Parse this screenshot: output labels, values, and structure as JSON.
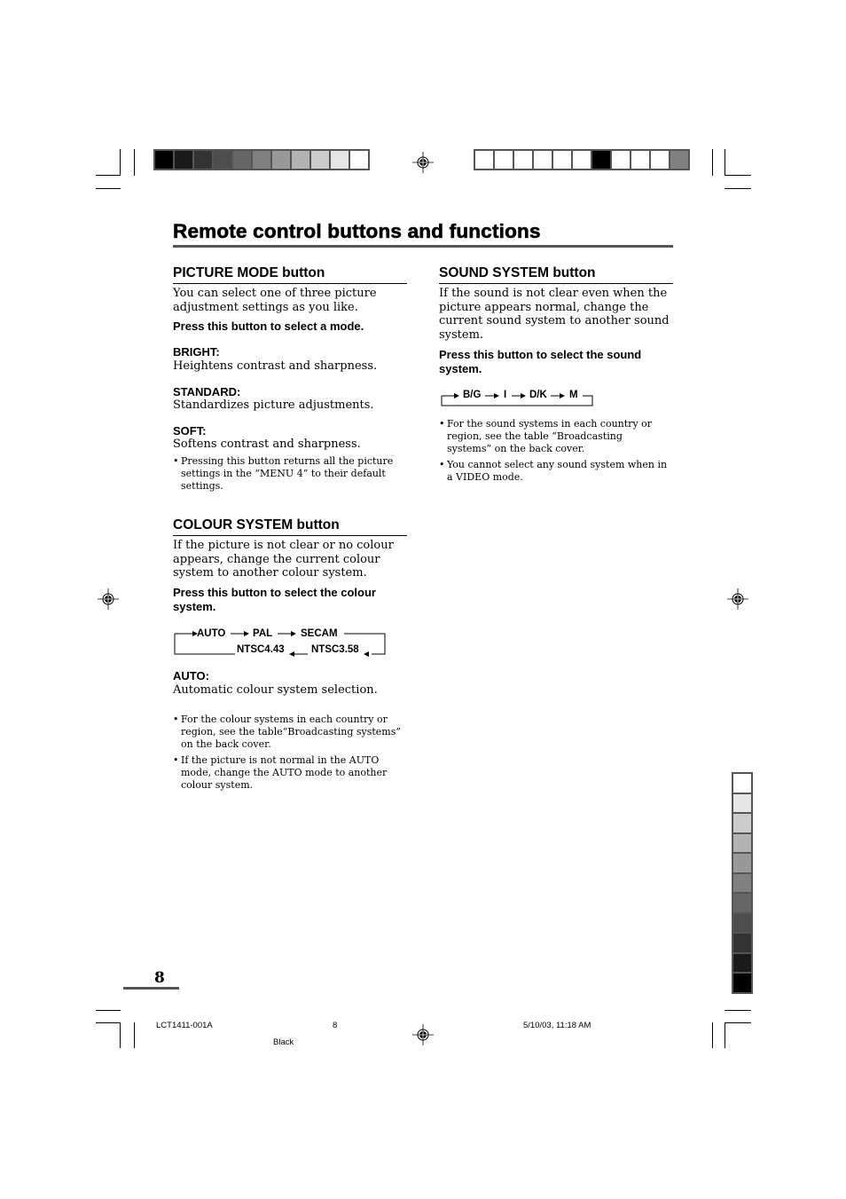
{
  "page": {
    "title": "Remote control buttons and functions",
    "page_number": "8"
  },
  "picture_mode": {
    "heading": "PICTURE MODE button",
    "intro": "You can select one of three picture adjustment settings as you like.",
    "instruction": "Press this button to select a mode.",
    "modes": [
      {
        "label": "BRIGHT:",
        "desc": "Heightens contrast and sharpness."
      },
      {
        "label": "STANDARD:",
        "desc": "Standardizes picture adjustments."
      },
      {
        "label": "SOFT:",
        "desc": "Softens contrast and sharpness."
      }
    ],
    "notes": [
      "Pressing this button returns all the picture settings in the “MENU 4” to their default settings."
    ]
  },
  "colour_system": {
    "heading": "COLOUR SYSTEM button",
    "intro": "If the picture is not clear or no colour appears, change the current colour system to another colour system.",
    "instruction": "Press this button to select the colour system.",
    "cycle": [
      "AUTO",
      "PAL",
      "SECAM",
      "NTSC3.58",
      "NTSC4.43"
    ],
    "modes": [
      {
        "label": "AUTO:",
        "desc": "Automatic colour system selection."
      }
    ],
    "notes": [
      "For the colour systems in each country or region, see the table“Broadcasting systems” on the back cover.",
      "If the picture is not normal in the AUTO mode,  change the AUTO mode to another colour system."
    ]
  },
  "sound_system": {
    "heading": "SOUND SYSTEM button",
    "intro": "If the sound is not clear even when the picture appears normal, change the current sound system to another sound system.",
    "instruction": "Press this button to select the sound system.",
    "cycle": [
      "B/G",
      "I",
      "D/K",
      "M"
    ],
    "notes": [
      "For the sound systems in each country or region, see the table “Broadcasting systems” on the back cover.",
      "You cannot select any sound system when in a VIDEO mode."
    ]
  },
  "print_footer": {
    "doc_code": "LCT1411-001A",
    "page": "8",
    "timestamp": "5/10/03, 11:18 AM",
    "plate": "Black"
  },
  "color_bars": {
    "top_left": [
      "#000000",
      "#1a1a1a",
      "#333333",
      "#4d4d4d",
      "#666666",
      "#808080",
      "#999999",
      "#b3b3b3",
      "#cccccc",
      "#e6e6e6",
      "#ffffff"
    ],
    "top_right": [
      "#ffffff",
      "#ffffff",
      "#ffffff",
      "#ffffff",
      "#ffffff",
      "#ffffff",
      "#000000",
      "#ffffff",
      "#ffffff",
      "#ffffff",
      "#808080"
    ],
    "side": [
      "#ffffff",
      "#e6e6e6",
      "#cccccc",
      "#b3b3b3",
      "#999999",
      "#808080",
      "#666666",
      "#4d4d4d",
      "#333333",
      "#1a1a1a",
      "#000000"
    ]
  }
}
